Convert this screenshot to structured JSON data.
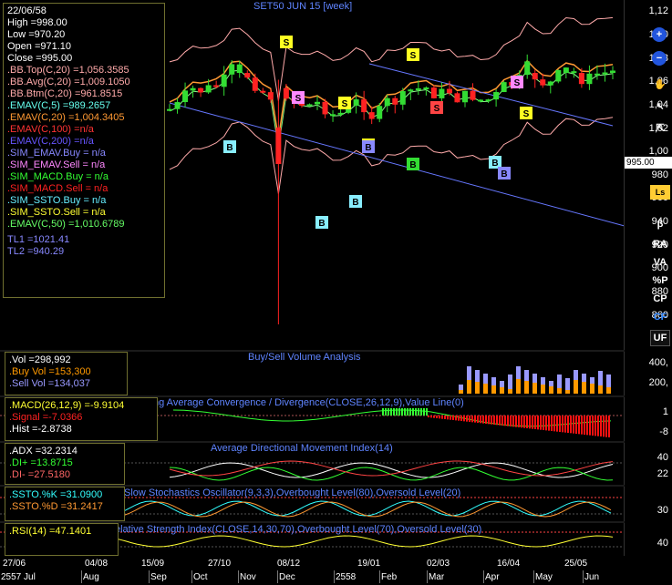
{
  "chart_title": "SET50 JUN 15  [week]",
  "info": {
    "date": "22/06/58",
    "high": "High  =998.00",
    "low": "Low  =970.20",
    "open": "Open  =971.10",
    "close": "Close  =995.00",
    "bbtop": ".BB.Top(C,20)  =1,056.3585",
    "bbavg": ".BB.Avg(C,20)  =1,009.1050",
    "bbbtm": ".BB.Btm(C,20)  =961.8515",
    "emav5": ".EMAV(C,5)  =989.2657",
    "emav20": ".EMAV(C,20)  =1,004.3405",
    "emav100": ".EMAV(C,100)  =n/a",
    "emav200": ".EMAV(C,200)  =n/a",
    "sim_emav_buy": ".SIM_EMAV.Buy  = n/a",
    "sim_emav_sell": ".SIM_EMAV.Sell  = n/a",
    "sim_macd_buy": ".SIM_MACD.Buy  = n/a",
    "sim_macd_sell": ".SIM_MACD.Sell  = n/a",
    "sim_ssto_buy": ".SIM_SSTO.Buy  = n/a",
    "sim_ssto_sell": ".SIM_SSTO.Sell  = n/a",
    "emav50": ".EMAV(C,50)  =1,010.6789",
    "tl1": "TL1 =1021.41",
    "tl2": "TL2 =940.29"
  },
  "price_axis": {
    "ticks": [
      "1,12",
      "1,10",
      "1,08",
      "1,06",
      "1,04",
      "1,02",
      "1,00",
      "980",
      "960",
      "940",
      "920",
      "900",
      "880",
      "860",
      "840"
    ],
    "current_value": "995.00"
  },
  "toolbar": {
    "plus": "+",
    "minus": "−",
    "hand": "✋",
    "arrow": "↖",
    "cursor": "⇱",
    "ls": "Ls",
    "beta": "β",
    "ra": "RA",
    "va": "VA",
    "pp": "%P",
    "cp": "CP",
    "cf": "CF",
    "uf": "UF"
  },
  "volume": {
    "title": "Buy/Sell Volume Analysis",
    "vol": ".Vol  =298,992",
    "buy": ".Buy Vol  =153,300",
    "sell": ".Sell Vol  =134,037",
    "ticks": [
      "400,",
      "200,"
    ]
  },
  "macd": {
    "title": "ng Average Convergence / Divergence(CLOSE,26,12,9),Value Line(0)",
    "line": ".MACD(26,12,9)  =-9.9104",
    "signal": ".Signal  =-7.0366",
    "hist": ".Hist =-2.8738",
    "ticks": [
      "1",
      "-8"
    ]
  },
  "adx": {
    "title": "Average Directional Movement Index(14)",
    "adx": ".ADX  =32.2314",
    "dip": ".DI+  =13.8715",
    "dim": ".DI-  =27.5180",
    "ticks": [
      "40",
      "22"
    ]
  },
  "ssto": {
    "title": "Slow Stochastics Oscillator(9,3,3),Overbought Level(80),Oversold Level(20)",
    "k": ".SSTO.%K  =31.0900",
    "d": ".SSTO.%D  =31.2417",
    "ticks": [
      "30"
    ]
  },
  "rsi": {
    "title": "elative Strength Index(CLOSE,14,30,70),Overbought Level(70),Oversold Level(30)",
    "rsi": ".RSI(14)  =47.1401",
    "ticks": [
      "40"
    ]
  },
  "dates": {
    "top": [
      "27/06",
      "04/08",
      "15/09",
      "27/10",
      "08/12",
      "19/01",
      "02/03",
      "16/04",
      "25/05"
    ],
    "bottom": [
      "2557 Jul",
      "Aug",
      "Sep",
      "Oct",
      "Nov",
      "Dec",
      "2558",
      "Feb",
      "Mar",
      "Apr",
      "May",
      "Jun"
    ]
  },
  "markers": [
    {
      "t": "S",
      "color": "#ffff22"
    },
    {
      "t": "S",
      "color": "#ff88ff"
    },
    {
      "t": "S",
      "color": "#ffff22"
    },
    {
      "t": "S",
      "color": "#ffff22"
    },
    {
      "t": "S",
      "color": "#ffff22"
    },
    {
      "t": "S",
      "color": "#ff4444"
    },
    {
      "t": "S",
      "color": "#ff88ff"
    },
    {
      "t": "S",
      "color": "#ffff22"
    },
    {
      "t": "B",
      "color": "#88eeff"
    },
    {
      "t": "B",
      "color": "#88eeff"
    },
    {
      "t": "B",
      "color": "#88eeff"
    },
    {
      "t": "B",
      "color": "#8888ff"
    },
    {
      "t": "B",
      "color": "#33dd33"
    },
    {
      "t": "B",
      "color": "#88eeff"
    },
    {
      "t": "B",
      "color": "#8888ff"
    }
  ],
  "colors": {
    "up": "#33dd33",
    "down": "#ff2222",
    "bb": "#ffaaaa",
    "emav5": "#88ff88",
    "emav20": "#ff9933",
    "channel": "#6677ff",
    "buy_vol": "#ff9900",
    "sell_vol": "#9999ff"
  }
}
